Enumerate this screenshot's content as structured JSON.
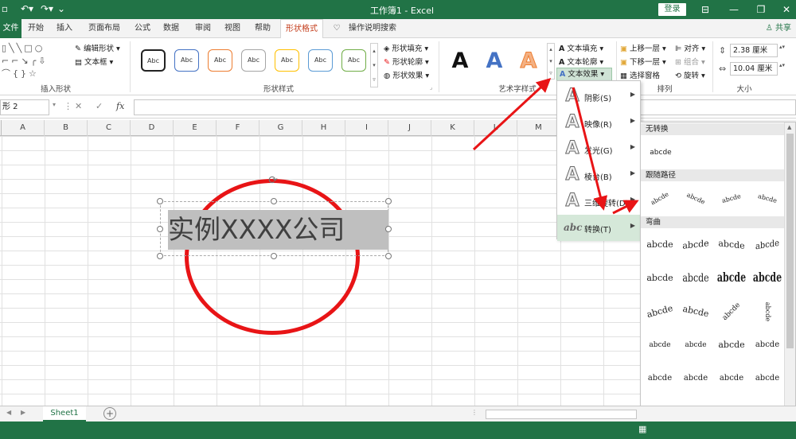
{
  "titlebar": {
    "title": "工作簿1 - Excel",
    "login": "登录"
  },
  "tabs": [
    {
      "label": "文件"
    },
    {
      "label": "开始"
    },
    {
      "label": "插入"
    },
    {
      "label": "页面布局"
    },
    {
      "label": "公式"
    },
    {
      "label": "数据"
    },
    {
      "label": "审阅"
    },
    {
      "label": "视图"
    },
    {
      "label": "帮助"
    },
    {
      "label": "形状格式"
    },
    {
      "label": "操作说明搜索"
    }
  ],
  "share": "共享",
  "ribbon": {
    "insert_shapes": {
      "label": "插入形状",
      "edit_shape": "编辑形状",
      "text_box": "文本框"
    },
    "shape_styles": {
      "label": "形状样式",
      "sample": "Abc",
      "fill": "形状填充",
      "outline": "形状轮廓",
      "effects": "形状效果"
    },
    "wordart": {
      "label": "艺术字样式",
      "glyph": "A",
      "text_fill": "文本填充",
      "text_outline": "文本轮廓",
      "text_effects": "文本效果"
    },
    "arrange": {
      "label": "排列",
      "bring_forward": "上移一层",
      "send_backward": "下移一层",
      "selection_pane": "选择窗格",
      "align": "对齐",
      "group": "组合",
      "rotate": "旋转"
    },
    "size": {
      "label": "大小",
      "height": "2.38 厘米",
      "width": "10.04 厘米"
    }
  },
  "formula": {
    "namebox": "形 2",
    "fx": "fx"
  },
  "columns": [
    "A",
    "B",
    "C",
    "D",
    "E",
    "F",
    "G",
    "H",
    "I",
    "J",
    "K",
    "L",
    "M"
  ],
  "canvas": {
    "textbox_text": "实例XXXX公司"
  },
  "effects_menu": {
    "items": [
      {
        "icon": "A",
        "label": "阴影(S)"
      },
      {
        "icon": "A",
        "label": "映像(R)"
      },
      {
        "icon": "A",
        "label": "发光(G)"
      },
      {
        "icon": "A",
        "label": "棱台(B)"
      },
      {
        "icon": "A",
        "label": "三维旋转(D)"
      },
      {
        "icon": "abc",
        "label": "转换(T)"
      }
    ]
  },
  "transform_menu": {
    "no_transform": "无转换",
    "no_transform_sample": "abcde",
    "follow_path": "跟随路径",
    "warp": "弯曲",
    "sample": "abcde"
  },
  "sheets": {
    "tab": "Sheet1",
    "add": "+"
  },
  "colors": {
    "excel_green": "#217346",
    "circle_red": "#e81416",
    "arrow_red": "#e81416",
    "active_tab": "#c43e1c"
  }
}
